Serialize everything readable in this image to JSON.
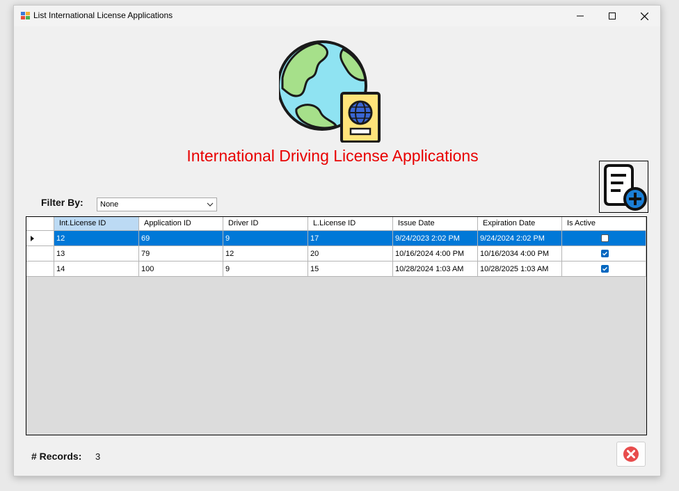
{
  "window": {
    "title": "List International License Applications"
  },
  "header": {
    "title": "International Driving License Applications"
  },
  "filter": {
    "label": "Filter By:",
    "selected": "None"
  },
  "grid": {
    "columns": [
      "Int.License ID",
      "Application ID",
      "Driver ID",
      "L.License ID",
      "Issue Date",
      "Expiration Date",
      "Is Active"
    ],
    "rows": [
      {
        "int_license_id": "12",
        "application_id": "69",
        "driver_id": "9",
        "l_license_id": "17",
        "issue_date": "9/24/2023 2:02 PM",
        "expiration_date": "9/24/2024 2:02 PM",
        "is_active": false,
        "selected": true
      },
      {
        "int_license_id": "13",
        "application_id": "79",
        "driver_id": "12",
        "l_license_id": "20",
        "issue_date": "10/16/2024 4:00 PM",
        "expiration_date": "10/16/2034 4:00 PM",
        "is_active": true,
        "selected": false
      },
      {
        "int_license_id": "14",
        "application_id": "100",
        "driver_id": "9",
        "l_license_id": "15",
        "issue_date": "10/28/2024 1:03 AM",
        "expiration_date": "10/28/2025 1:03 AM",
        "is_active": true,
        "selected": false
      }
    ]
  },
  "footer": {
    "records_label": "# Records:",
    "records_count": "3"
  },
  "icons": {
    "add": "add-document-icon",
    "close": "close-circle-icon",
    "logo": "globe-passport-icon"
  },
  "colors": {
    "title": "#e80000",
    "selection": "#0078d7",
    "close_icon": "#e84c4c",
    "add_icon": "#1b7fd6"
  }
}
